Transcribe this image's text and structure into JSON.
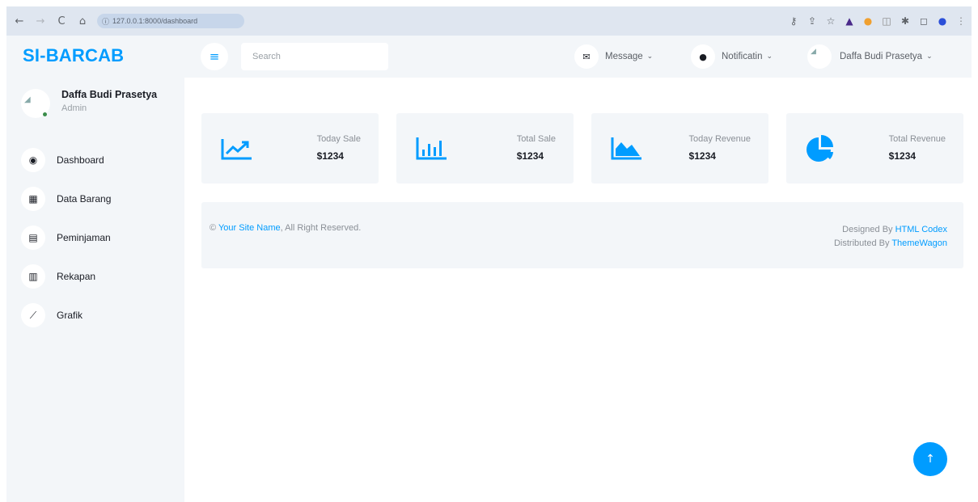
{
  "browser": {
    "url": "127.0.0.1:8000/dashboard",
    "back_icon": "←",
    "forward_icon": "→",
    "reload_icon": "C",
    "home_icon": "⌂",
    "info_icon": "ⓘ"
  },
  "brand": {
    "title": "SI-BARCAB",
    "color": "#009cff"
  },
  "profile": {
    "name": "Daffa Budi Prasetya",
    "role": "Admin"
  },
  "sidebar": {
    "items": [
      {
        "label": "Dashboard",
        "icon": "tachometer-icon",
        "glyph": "◉"
      },
      {
        "label": "Data Barang",
        "icon": "table-icon",
        "glyph": "▦"
      },
      {
        "label": "Peminjaman",
        "icon": "keyboard-icon",
        "glyph": "▤"
      },
      {
        "label": "Rekapan",
        "icon": "table-list-icon",
        "glyph": "▥"
      },
      {
        "label": "Grafik",
        "icon": "chart-line-icon",
        "glyph": "⟋"
      }
    ]
  },
  "topbar": {
    "menu_glyph": "≡",
    "search_placeholder": "Search",
    "message_label": "Message",
    "message_glyph": "✉",
    "notification_label": "Notificatin",
    "notification_glyph": "●",
    "user_name": "Daffa Budi Prasetya",
    "chevron": "⌄"
  },
  "cards": [
    {
      "label": "Today Sale",
      "value": "$1234",
      "icon": "chart-line-icon"
    },
    {
      "label": "Total Sale",
      "value": "$1234",
      "icon": "chart-bar-icon"
    },
    {
      "label": "Today Revenue",
      "value": "$1234",
      "icon": "chart-area-icon"
    },
    {
      "label": "Total Revenue",
      "value": "$1234",
      "icon": "chart-pie-icon"
    }
  ],
  "footer": {
    "copyright_symbol": "©",
    "site_name": "Your Site Name",
    "rights": ", All Right Reserved.",
    "designed_by": "Designed By ",
    "designer": "HTML Codex",
    "distributed_by": "Distributed By ",
    "distributor": "ThemeWagon"
  },
  "back_to_top_glyph": "↑",
  "colors": {
    "accent": "#009cff",
    "panel": "#f3f6f9",
    "dark": "#191c24"
  }
}
